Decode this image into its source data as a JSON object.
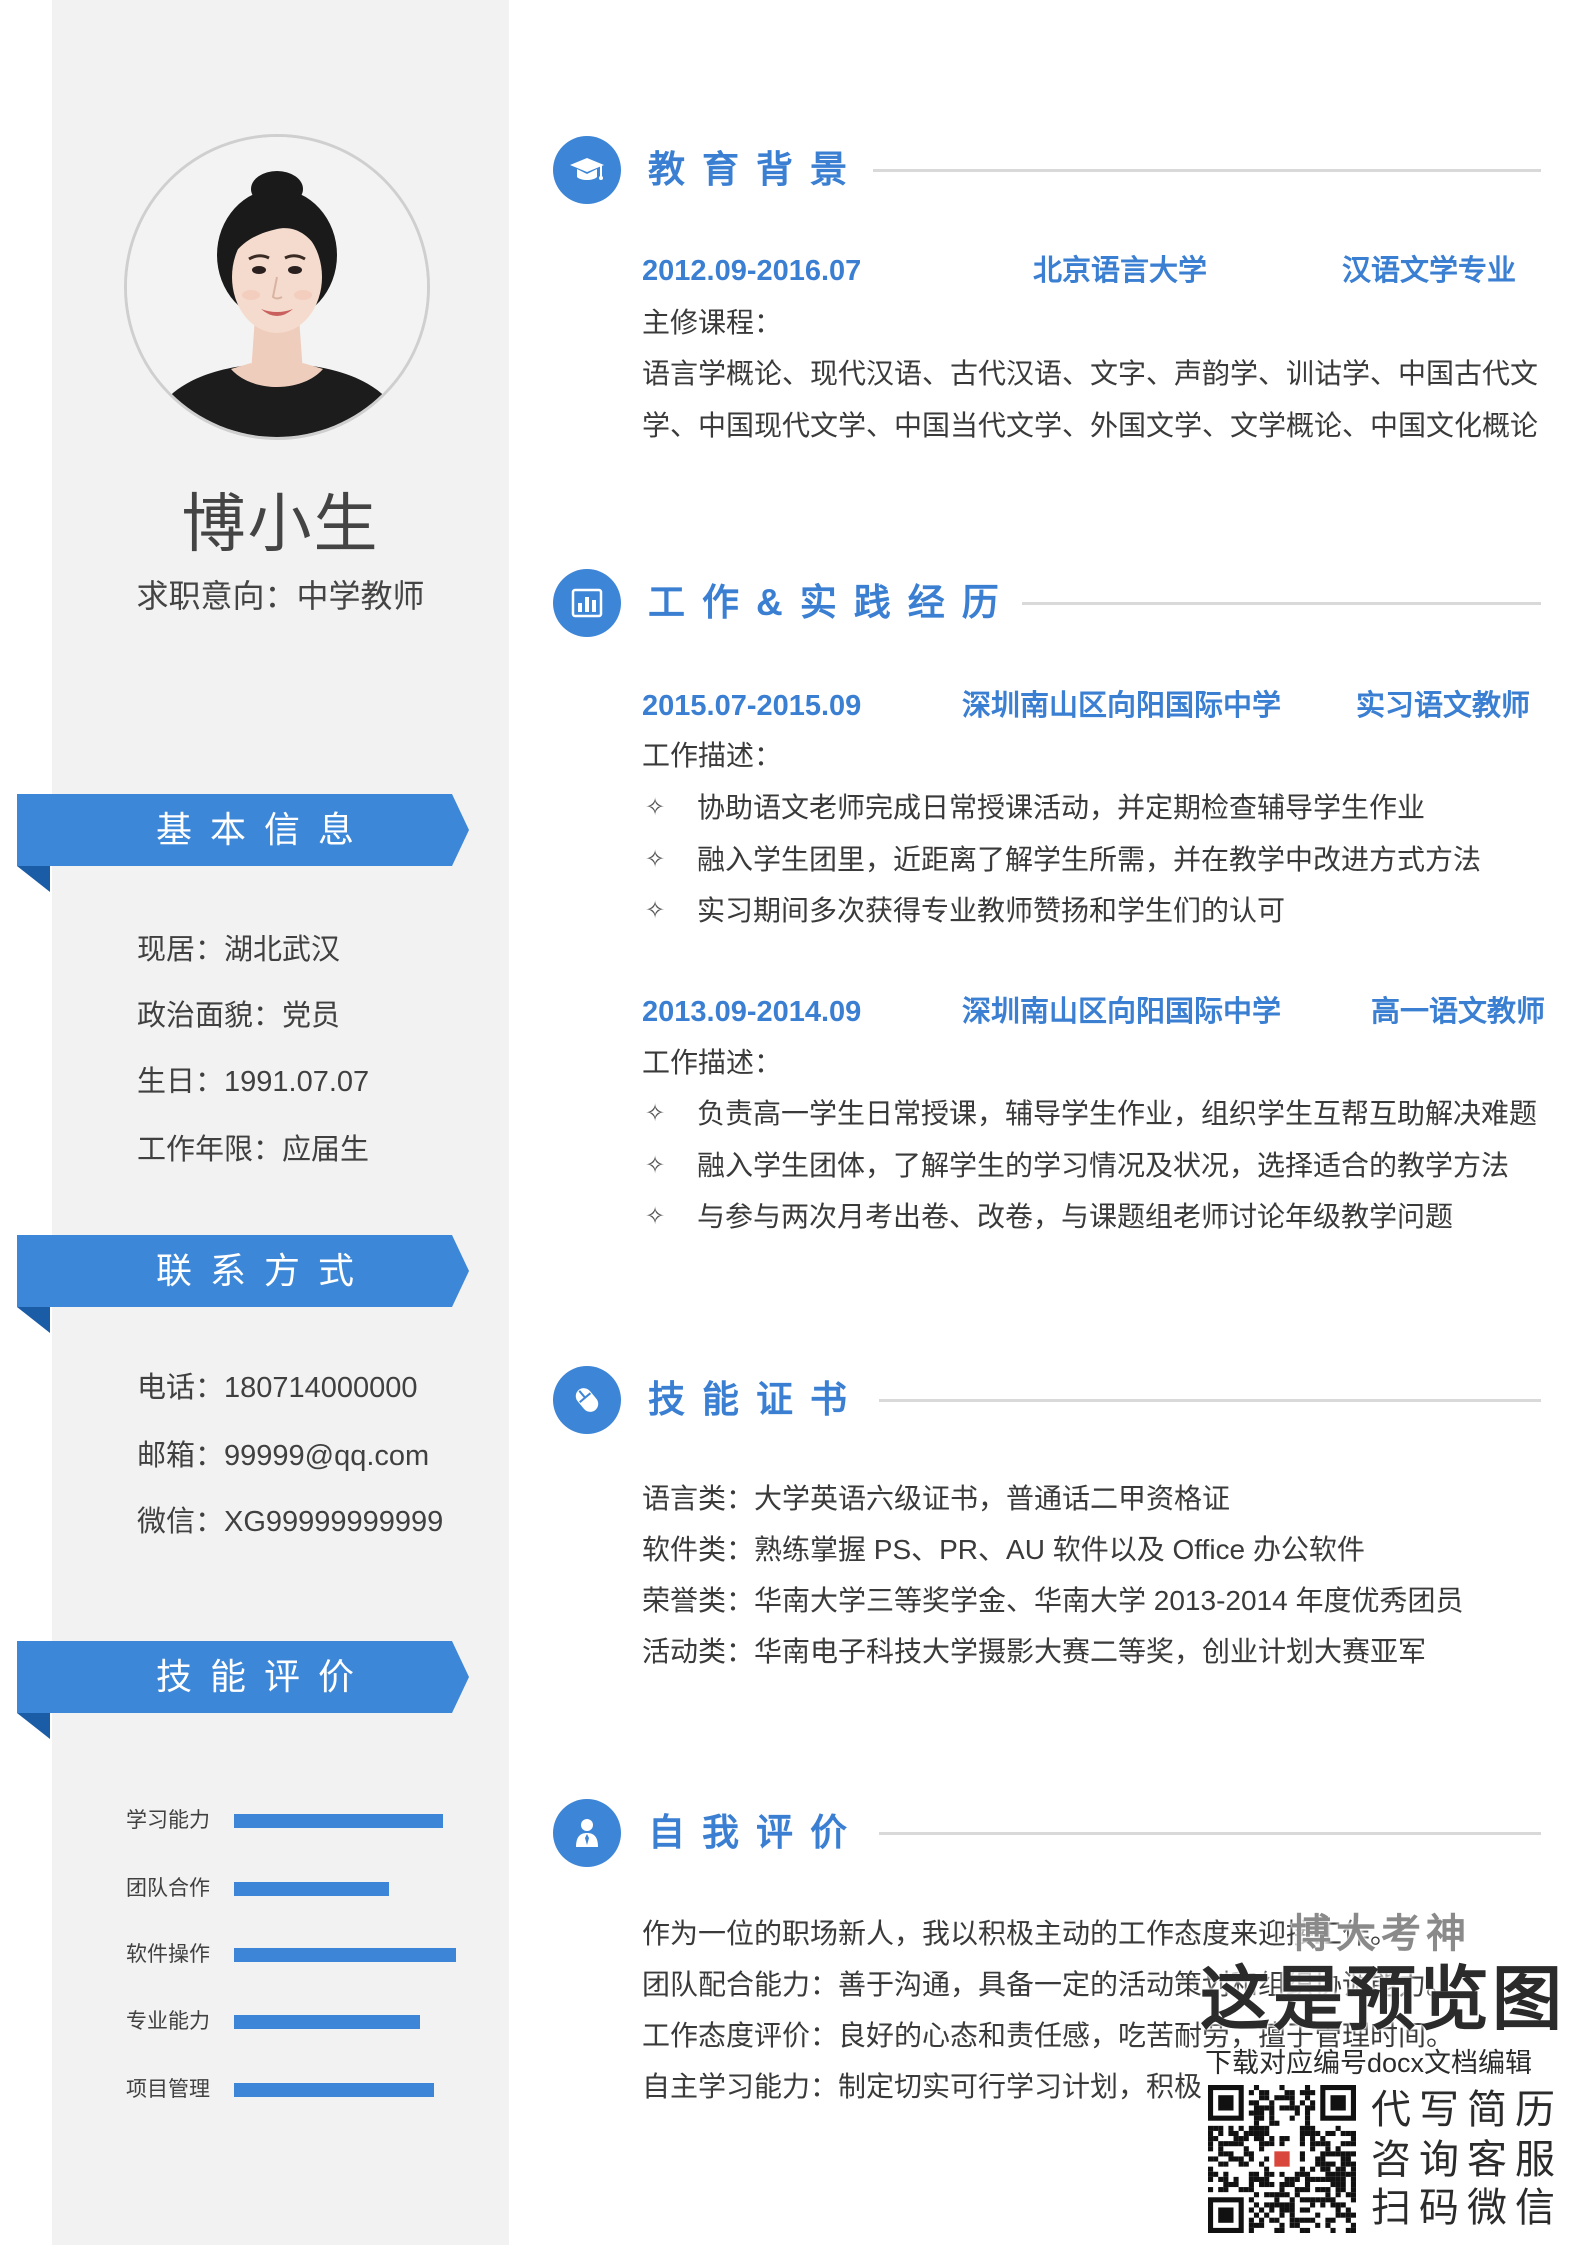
{
  "colors": {
    "accent": "#3b7fd2",
    "banner": "#3d87d8",
    "banner_fold": "#1b5ca6",
    "sidebar_bg": "#f2f2f2",
    "divider": "#d9d9d9",
    "body_text": "#3a3a3a"
  },
  "profile": {
    "name": "博小生",
    "intention": "求职意向：中学教师"
  },
  "sidebar": {
    "basic_info": {
      "title": "基本信息",
      "items": [
        "现居：湖北武汉",
        "政治面貌：党员",
        "生日：1991.07.07",
        "工作年限：应届生"
      ]
    },
    "contact": {
      "title": "联系方式",
      "items": [
        "电话：180714000000",
        "邮箱：99999@qq.com",
        "微信：XG99999999999"
      ]
    },
    "skills": {
      "title": "技能评价",
      "items": [
        {
          "label": "学习能力",
          "level": 0.94
        },
        {
          "label": "团队合作",
          "level": 0.7
        },
        {
          "label": "软件操作",
          "level": 1.0
        },
        {
          "label": "专业能力",
          "level": 0.84
        },
        {
          "label": "项目管理",
          "level": 0.9
        }
      ]
    }
  },
  "education": {
    "title": "教育背景",
    "icon": "graduation-cap-icon",
    "period": "2012.09-2016.07",
    "school": "北京语言大学",
    "major": "汉语文学专业",
    "courses_label": "主修课程：",
    "courses": "语言学概论、现代汉语、古代汉语、文字、声韵学、训诂学、中国古代文学、中国现代文学、中国当代文学、外国文学、文学概论、中国文化概论"
  },
  "work": {
    "title": "工作&实践经历",
    "icon": "bar-chart-icon",
    "bullet_symbol": "✧",
    "jobs": [
      {
        "period": "2015.07-2015.09",
        "org": "深圳南山区向阳国际中学",
        "role": "实习语文教师",
        "desc_label": "工作描述：",
        "bullets": [
          "协助语文老师完成日常授课活动，并定期检查辅导学生作业",
          "融入学生团里，近距离了解学生所需，并在教学中改进方式方法",
          "实习期间多次获得专业教师赞扬和学生们的认可"
        ]
      },
      {
        "period": "2013.09-2014.09",
        "org": "深圳南山区向阳国际中学",
        "role": "高一语文教师",
        "desc_label": "工作描述：",
        "bullets": [
          "负责高一学生日常授课，辅导学生作业，组织学生互帮互助解决难题",
          "融入学生团体，了解学生的学习情况及状况，选择适合的教学方法",
          "与参与两次月考出卷、改卷，与课题组老师讨论年级教学问题"
        ]
      }
    ]
  },
  "certificates": {
    "title": "技能证书",
    "icon": "mouse-icon",
    "items": [
      "语言类：大学英语六级证书，普通话二甲资格证",
      "软件类：熟练掌握 PS、PR、AU 软件以及 Office 办公软件",
      "荣誉类：华南大学三等奖学金、华南大学 2013-2014 年度优秀团员",
      "活动类：华南电子科技大学摄影大赛二等奖，创业计划大赛亚军"
    ]
  },
  "self_evaluation": {
    "title": "自我评价",
    "icon": "person-icon",
    "items": [
      "作为一位的职场新人，我以积极主动的工作态度来迎接工作。",
      "团队配合能力：善于沟通，具备一定的活动策划和组织协调能力。",
      "工作态度评价：良好的心态和责任感，吃苦耐劳，擅于管理时间。",
      "自主学习能力：制定切实可行学习计划，积极"
    ]
  },
  "watermark": {
    "brand": "博大考神",
    "preview": "这是预览图",
    "download": "下载对应编号docx文档编辑",
    "services": [
      "代写简历",
      "咨询客服",
      "扫码微信"
    ],
    "icon": "qr-code"
  }
}
